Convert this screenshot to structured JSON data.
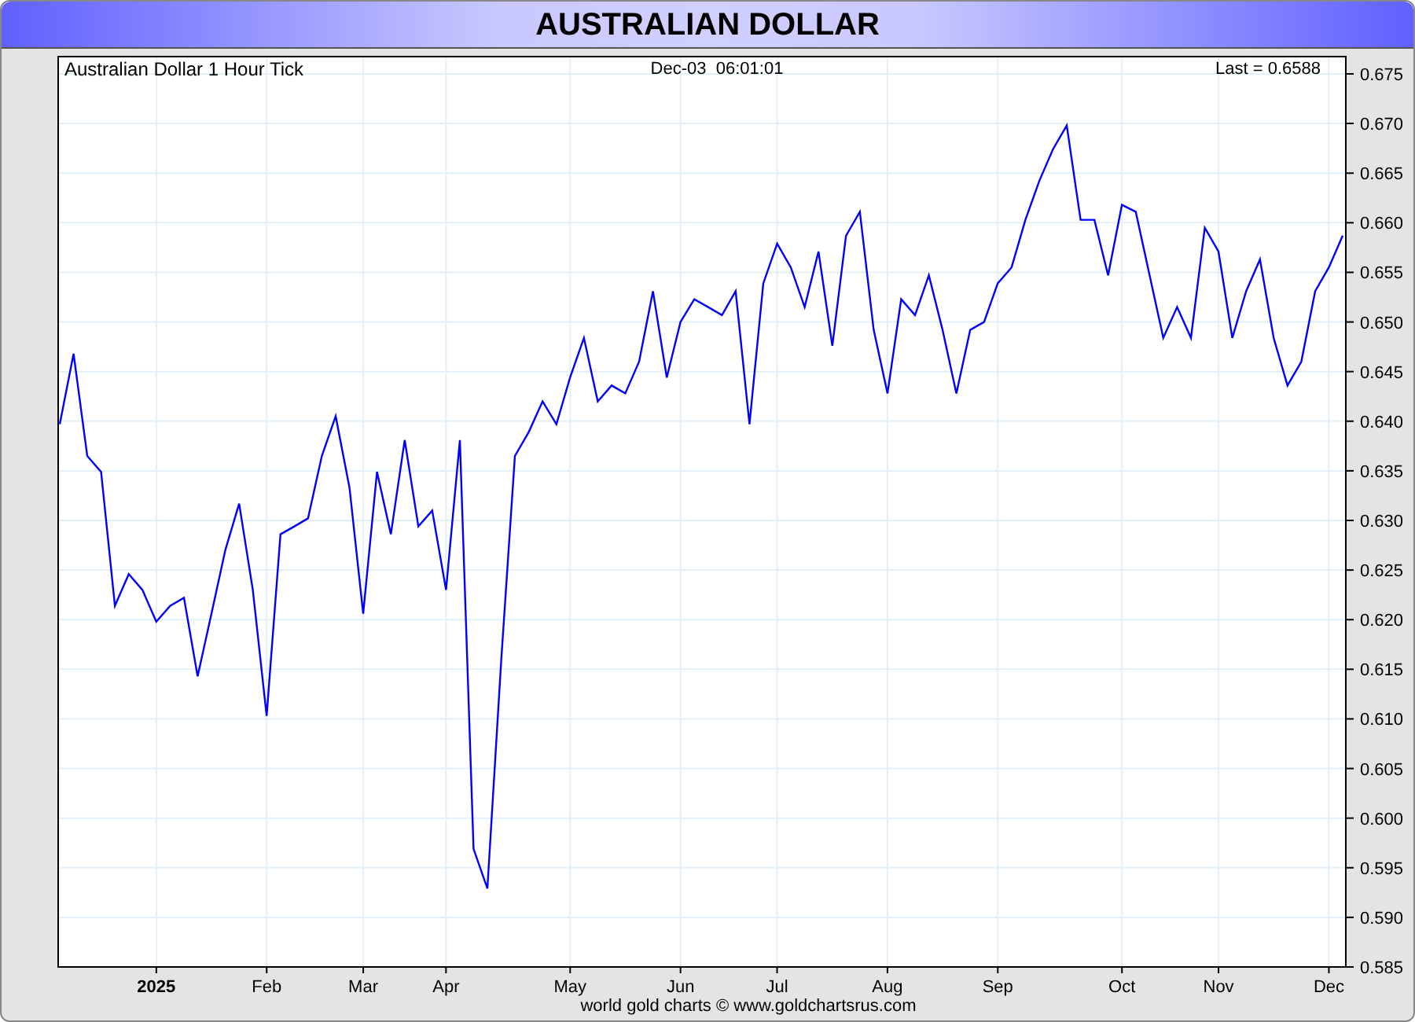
{
  "window": {
    "title": "AUSTRALIAN DOLLAR"
  },
  "chart": {
    "timestamp": "Dec-03  06:01:01",
    "last": "Last = 0.6588",
    "footer": "world gold charts © www.goldchartsrus.com",
    "chart_data": {
      "type": "line",
      "grid": true,
      "title": "Australian Dollar 1 Hour Tick",
      "ylim": [
        0.585,
        0.675
      ],
      "categories": [
        null,
        null,
        null,
        null,
        null,
        null,
        null,
        "2025",
        null,
        null,
        null,
        null,
        null,
        null,
        null,
        "Feb",
        null,
        null,
        null,
        null,
        null,
        null,
        "Mar",
        null,
        null,
        null,
        null,
        null,
        "Apr",
        null,
        null,
        null,
        null,
        null,
        null,
        null,
        null,
        "May",
        null,
        null,
        null,
        null,
        null,
        null,
        null,
        "Jun",
        null,
        null,
        null,
        null,
        null,
        null,
        "Jul",
        null,
        null,
        null,
        null,
        null,
        null,
        null,
        "Aug",
        null,
        null,
        null,
        null,
        null,
        null,
        null,
        "Sep",
        null,
        null,
        null,
        null,
        null,
        null,
        null,
        null,
        "Oct",
        null,
        null,
        null,
        null,
        null,
        null,
        "Nov",
        null,
        null,
        null,
        null,
        null,
        null,
        null,
        "Dec",
        null
      ],
      "yticks": [
        {
          "value": 0.585,
          "label": "0.585"
        },
        {
          "value": 0.59,
          "label": "0.590"
        },
        {
          "value": 0.595,
          "label": "0.595"
        },
        {
          "value": 0.6,
          "label": "0.600"
        },
        {
          "value": 0.605,
          "label": "0.605"
        },
        {
          "value": 0.61,
          "label": "0.610"
        },
        {
          "value": 0.615,
          "label": "0.615"
        },
        {
          "value": 0.62,
          "label": "0.620"
        },
        {
          "value": 0.625,
          "label": "0.625"
        },
        {
          "value": 0.63,
          "label": "0.630"
        },
        {
          "value": 0.635,
          "label": "0.635"
        },
        {
          "value": 0.64,
          "label": "0.640"
        },
        {
          "value": 0.645,
          "label": "0.645"
        },
        {
          "value": 0.65,
          "label": "0.650"
        },
        {
          "value": 0.655,
          "label": "0.655"
        },
        {
          "value": 0.66,
          "label": "0.660"
        },
        {
          "value": 0.665,
          "label": "0.665"
        },
        {
          "value": 0.67,
          "label": "0.670"
        },
        {
          "value": 0.675,
          "label": "0.675"
        }
      ],
      "series": [
        {
          "color": "#0000ff",
          "values": [
            0.6397,
            0.6468,
            0.6365,
            0.6349,
            0.6214,
            0.6246,
            0.623,
            0.6198,
            0.6214,
            0.6222,
            0.6143,
            0.6206,
            0.627,
            0.6317,
            0.623,
            0.6103,
            0.6286,
            0.6294,
            0.6302,
            0.6365,
            0.6405,
            0.6333,
            0.6206,
            0.6349,
            0.6286,
            0.6381,
            0.6294,
            0.631,
            0.623,
            0.6381,
            0.5969,
            0.5929,
            0.6159,
            0.6365,
            0.6389,
            0.642,
            0.6397,
            0.6444,
            0.6484,
            0.642,
            0.6436,
            0.6428,
            0.646,
            0.6531,
            0.6444,
            0.65,
            0.6523,
            0.6515,
            0.6507,
            0.6531,
            0.6397,
            0.6539,
            0.6579,
            0.6555,
            0.6515,
            0.6571,
            0.6476,
            0.6587,
            0.6611,
            0.6492,
            0.6428,
            0.6523,
            0.6507,
            0.6547,
            0.6492,
            0.6428,
            0.6492,
            0.65,
            0.6539,
            0.6555,
            0.6603,
            0.6642,
            0.6674,
            0.6698,
            0.6603,
            0.6603,
            0.6547,
            0.6618,
            0.6611,
            0.6547,
            0.6484,
            0.6515,
            0.6484,
            0.6595,
            0.6571,
            0.6484,
            0.6531,
            0.6563,
            0.6484,
            0.6436,
            0.646,
            0.6531,
            0.6555,
            0.6587
          ]
        }
      ]
    }
  }
}
